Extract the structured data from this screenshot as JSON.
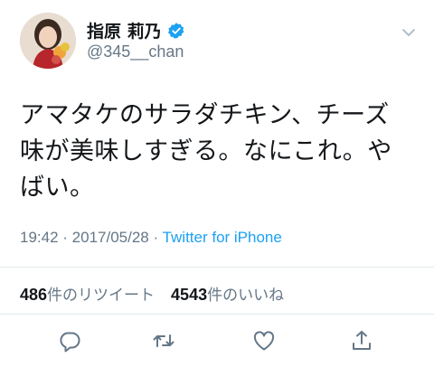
{
  "user": {
    "display_name": "指原 莉乃",
    "handle": "@345__chan"
  },
  "tweet": {
    "lines": [
      "アマタケのサラダチキン、チーズ",
      "味が美味しすぎる。なにこれ。や",
      "ばい。"
    ],
    "time": "19:42",
    "date": "2017/05/28",
    "separator": " · ",
    "source": "Twitter for iPhone"
  },
  "stats": {
    "retweets": "486",
    "retweets_label": "件のリツイート",
    "likes": "4543",
    "likes_label": "件のいいね"
  },
  "icons": [
    "verified-icon",
    "caret-down-icon",
    "reply-icon",
    "retweet-icon",
    "like-icon",
    "share-icon"
  ],
  "colors": {
    "accent": "#1da1f2",
    "secondary_text": "#657786",
    "primary_text": "#14171a",
    "divider": "#e1e8ed"
  }
}
